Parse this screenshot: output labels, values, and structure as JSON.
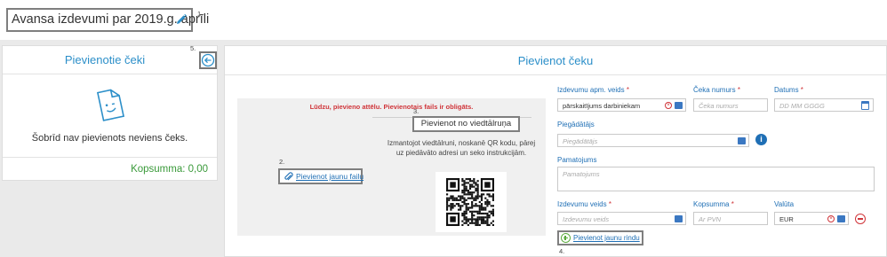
{
  "header": {
    "title": "Avansa izdevumi par 2019.g. aprīli",
    "step": "1."
  },
  "left_panel": {
    "title": "Pievienotie čeki",
    "back_step": "5.",
    "empty_text": "Šobrīd nav pievienots neviens čeks.",
    "sum_label": "Kopsumma: 0,00"
  },
  "right_panel": {
    "title": "Pievienot čeku",
    "upload": {
      "error": "Lūdzu, pievieno attēlu. Pievienotais fails ir obligāts.",
      "add_file_step": "2.",
      "add_file_label": "Pievienot jaunu failu",
      "mobile_step": "3.",
      "mobile_button": "Pievienot no viedtālruņa",
      "mobile_text": "Izmantojot viedtālruni, noskanē QR kodu, pārej uz piedāvāto adresi un seko instrukcijām."
    },
    "form": {
      "expense_type_label": "Izdevumu apm. veids",
      "expense_type_value": "pārskaitījums darbiniekam",
      "receipt_number_label": "Čeka numurs",
      "receipt_number_placeholder": "Čeka numurs",
      "date_label": "Datums",
      "date_placeholder": "DD MM GGGG",
      "supplier_label": "Piegādātājs",
      "supplier_placeholder": "Piegādātājs",
      "justification_label": "Pamatojums",
      "justification_placeholder": "Pamatojums",
      "cost_type_label": "Izdevumu veids",
      "cost_type_placeholder": "Izdevumu veids",
      "total_label": "Kopsumma",
      "total_placeholder": "Ar PVN",
      "currency_label": "Valūta",
      "currency_value": "EUR",
      "add_row_label": "Pievienot jaunu rindu",
      "add_row_step": "4.",
      "required_mark": "*"
    }
  },
  "colors": {
    "accent": "#2c8fc9",
    "link": "#1f6fb5",
    "error": "#d0353a",
    "success": "#3a9a3a",
    "callout_border": "#7f7f7f"
  }
}
